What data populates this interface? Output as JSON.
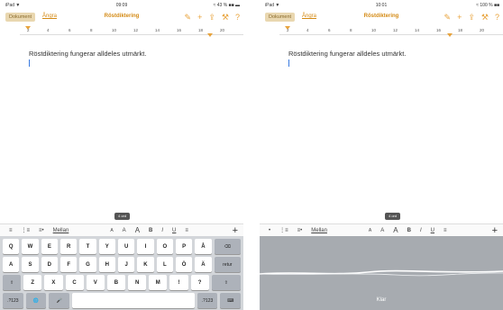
{
  "left": {
    "status": {
      "carrier": "iPad ▼",
      "time": "09:09",
      "battery": "≈ 43 % ■■ ▬"
    },
    "toolbar": {
      "document": "Dokument",
      "undo": "Ångra",
      "title": "Röstdiktering"
    },
    "ruler_ticks": [
      "2",
      "4",
      "6",
      "8",
      "10",
      "12",
      "14",
      "16",
      "18",
      "20"
    ],
    "body_text": "Röstdiktering fungerar alldeles utmärkt.",
    "word_count": "4 ord",
    "format_bar": [
      "≡",
      "⋮≡",
      "≡•",
      "Mellan",
      "A",
      "A",
      "A",
      "B",
      "I",
      "U",
      "≡"
    ],
    "keyboard": {
      "row1": [
        "Q",
        "W",
        "E",
        "R",
        "T",
        "Y",
        "U",
        "I",
        "O",
        "P",
        "Å",
        "⌫"
      ],
      "row2": [
        "A",
        "S",
        "D",
        "F",
        "G",
        "H",
        "J",
        "K",
        "L",
        "Ö",
        "Ä",
        "retur"
      ],
      "row3": [
        "⇧",
        "Z",
        "X",
        "C",
        "V",
        "B",
        "N",
        "M",
        "!",
        "?",
        "⇧"
      ],
      "row4": [
        ".?123",
        "🌐",
        "🎤",
        "",
        ".?123",
        "⌨"
      ]
    }
  },
  "right": {
    "status": {
      "carrier": "iPad ▼",
      "time": "10:01",
      "battery": "≈ 100 % ■■"
    },
    "toolbar": {
      "document": "Dokument",
      "undo": "Ångra",
      "title": "Röstdiktering"
    },
    "ruler_ticks": [
      "2",
      "4",
      "6",
      "8",
      "10",
      "12",
      "14",
      "16",
      "18",
      "20"
    ],
    "body_text": "Röstdiktering fungerar alldeles utmärkt.",
    "word_count": "4 ord",
    "format_bar": [
      "•",
      "⋮≡",
      "≡•",
      "Mellan",
      "A",
      "A",
      "A",
      "B",
      "I",
      "U",
      "≡"
    ],
    "dictation_done": "Klar"
  },
  "colors": {
    "accent": "#d48a14",
    "icon": "#e8a33c",
    "caret": "#3a7be0"
  }
}
